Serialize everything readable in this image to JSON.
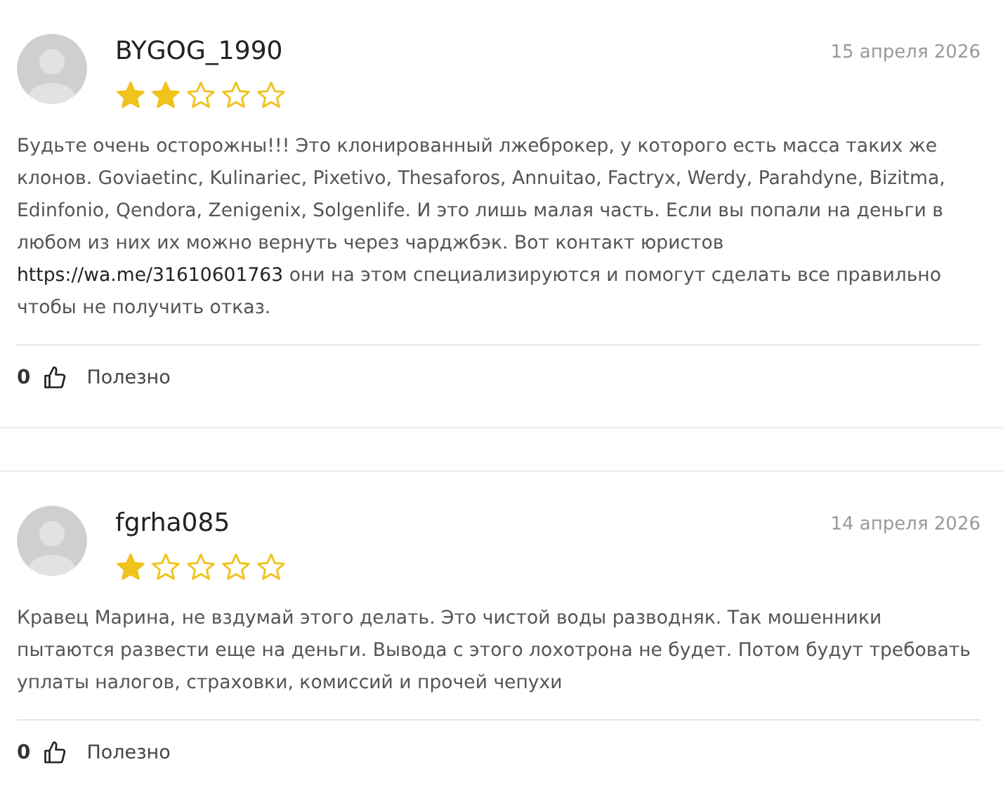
{
  "reviews": [
    {
      "author": "BYGOG_1990",
      "date": "15 апреля 2026",
      "stars": 2,
      "body": [
        {
          "kind": "text",
          "text": "Будьте очень осторожны!!! Это клонированный лжеброкер, у которого есть масса таких же клонов. Goviaetinc, Kulinariec, Pixetivo, Thesaforos, Annuitao, Factryx, Werdy, Parahdyne, Bizitma, Edinfonio, Qendora, Zenigenix, Solgenlife. И это лишь малая часть. Если вы попали на деньги в любом из них их можно вернуть через чарджбэк. Вот контакт юристов "
        },
        {
          "kind": "link",
          "text": "https://wa.me/31610601763"
        },
        {
          "kind": "text",
          "text": " они на этом специализируются и помогут сделать все правильно чтобы не получить отказ."
        }
      ],
      "likes": "0",
      "helpful": "Полезно"
    },
    {
      "author": "fgrha085",
      "date": "14 апреля 2026",
      "stars": 1,
      "body": [
        {
          "kind": "text",
          "text": "Кравец Марина, не вздумай этого делать. Это чистой воды разводняк. Так мошенники пытаются развести еще на деньги. Вывода с этого лохотрона не будет. Потом будут требовать уплаты налогов, страховки, комиссий и прочей чепухи"
        }
      ],
      "likes": "0",
      "helpful": "Полезно"
    }
  ]
}
